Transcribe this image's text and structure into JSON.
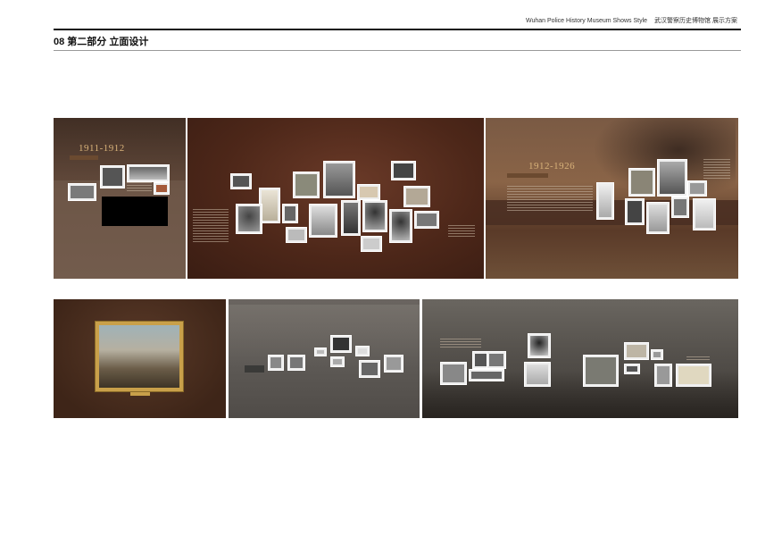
{
  "header": {
    "right_en": "Wuhan Police History Museum Shows Style",
    "right_cn": "武汉警察历史博物馆 展示方案"
  },
  "page": {
    "title": "08 第二部分 立面设计"
  },
  "panels": {
    "p1": {
      "year": "1911-1912"
    },
    "p3": {
      "year": "1912-1926"
    }
  },
  "colors": {
    "brown_dark": "#4a2a1e",
    "brown_mid": "#6b5245",
    "gray_panel": "#5d5955",
    "gold_accent": "#d9b37a"
  }
}
